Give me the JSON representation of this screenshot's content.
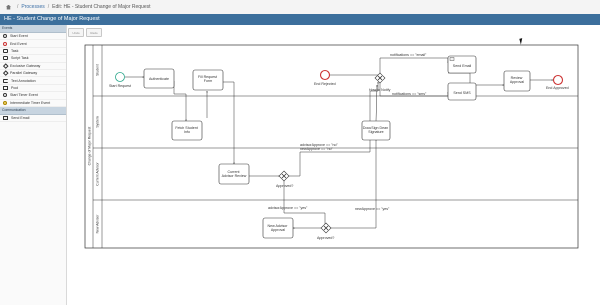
{
  "breadcrumb": {
    "processes": "Processes",
    "sep1": "/",
    "sep2": "/",
    "current": "Edit: HE - Student Change of Major Request"
  },
  "title": "HE - Student Change of Major Request",
  "sidebar": {
    "section1": "Events",
    "items": [
      {
        "label": "Start Event",
        "icon": "circle-icon"
      },
      {
        "label": "End Event",
        "icon": "end-circle-icon"
      },
      {
        "label": "Task",
        "icon": "task-icon"
      },
      {
        "label": "Script Task",
        "icon": "script-task-icon"
      },
      {
        "label": "Exclusive Gateway",
        "icon": "diamond-icon"
      },
      {
        "label": "Parallel Gateway",
        "icon": "diamond-icon"
      },
      {
        "label": "Text Annotation",
        "icon": "annotation-icon"
      },
      {
        "label": "Pool",
        "icon": "pool-icon"
      },
      {
        "label": "Start Timer Event",
        "icon": "timer-icon"
      },
      {
        "label": "Intermediate Timer Event",
        "icon": "timer-icon"
      }
    ],
    "section2": "Communication",
    "items2": [
      {
        "label": "Send Email",
        "icon": "mail-icon"
      }
    ]
  },
  "toolbar": {
    "undo": "Undo",
    "redo": "Redo"
  },
  "diagram": {
    "pool": "Change of Major Request",
    "lanes": [
      "Student",
      "System",
      "Current Advisor",
      "New Advisor"
    ],
    "tasks": {
      "authenticate": "Authenticate",
      "fill_request": [
        "Fill Request",
        "Form"
      ],
      "fetch_info": [
        "Fetch Student",
        "Info"
      ],
      "current_review": [
        "Current",
        "Advisor Review"
      ],
      "new_approval": [
        "New Advisor",
        "Approval"
      ],
      "docusign": [
        "DocuSign Dean",
        "Signature"
      ],
      "send_email": "Send Email",
      "send_sms": "Send SMS",
      "review_approval": [
        "Review",
        "Approval"
      ]
    },
    "events": {
      "start": "Start Request",
      "end_rejected": "End Rejected",
      "end_approved": "End Approved"
    },
    "gateways": {
      "notify": "How to Notify",
      "approved1": "Approved?",
      "approved2": "Approved?"
    },
    "flows": {
      "email": "notifications == \"email\"",
      "sms": "notifications == \"sms\"",
      "no1": [
        "advisorApprove == \"no\"",
        "newApprove == \"no\""
      ],
      "yes1": "advisorApprove == \"yes\"",
      "yes2": "newApprove == \"yes\""
    }
  }
}
